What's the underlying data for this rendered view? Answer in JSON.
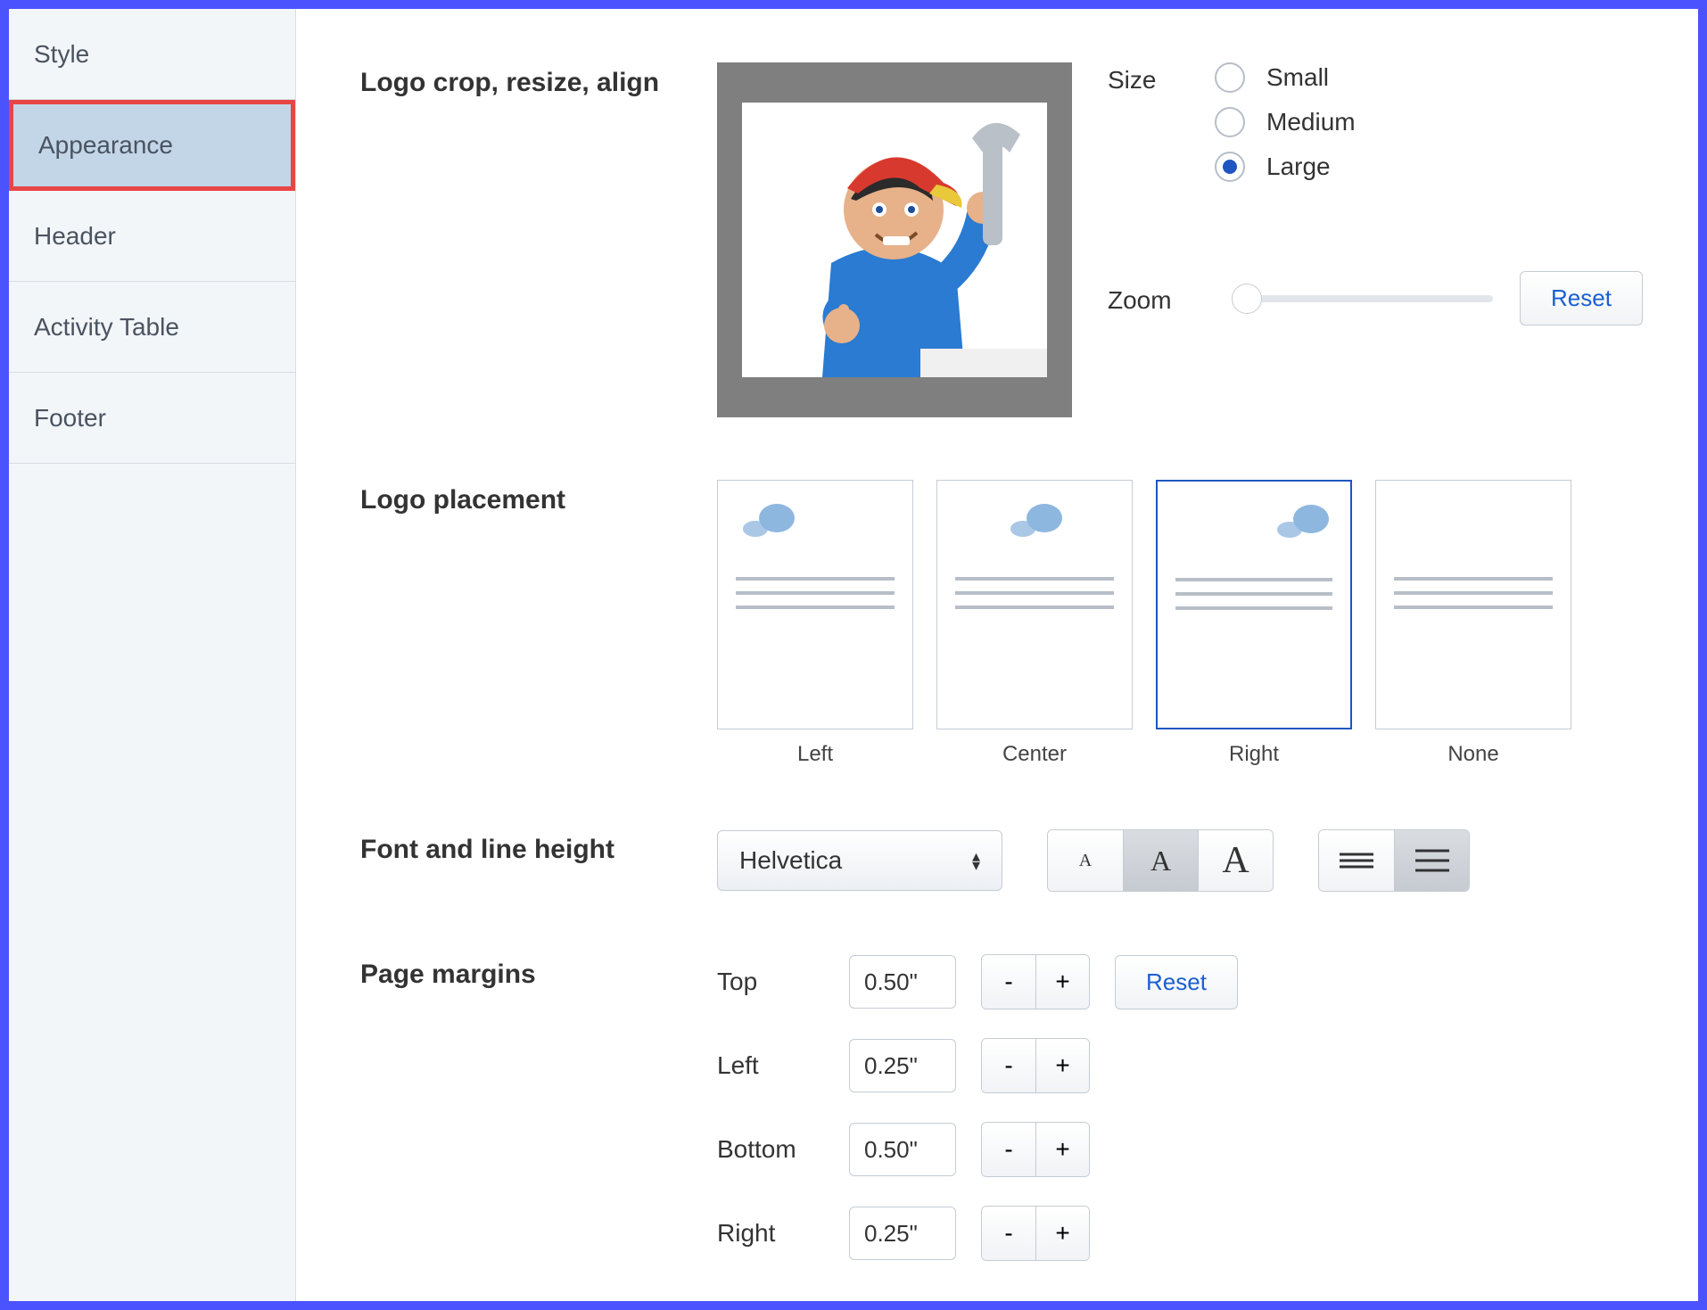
{
  "sidebar": {
    "items": [
      {
        "label": "Style"
      },
      {
        "label": "Appearance",
        "active": true
      },
      {
        "label": "Header"
      },
      {
        "label": "Activity Table"
      },
      {
        "label": "Footer"
      }
    ]
  },
  "logo": {
    "section_label": "Logo crop, resize, align",
    "size_label": "Size",
    "size_options": [
      "Small",
      "Medium",
      "Large"
    ],
    "size_selected": "Large",
    "zoom_label": "Zoom",
    "reset_label": "Reset"
  },
  "placement": {
    "section_label": "Logo placement",
    "options": [
      "Left",
      "Center",
      "Right",
      "None"
    ],
    "selected": "Right"
  },
  "font": {
    "section_label": "Font and line height",
    "family": "Helvetica",
    "font_size_selected": "medium",
    "line_height_selected": "loose"
  },
  "margins": {
    "section_label": "Page margins",
    "reset_label": "Reset",
    "rows": [
      {
        "label": "Top",
        "value": "0.50\""
      },
      {
        "label": "Left",
        "value": "0.25\""
      },
      {
        "label": "Bottom",
        "value": "0.50\""
      },
      {
        "label": "Right",
        "value": "0.25\""
      }
    ]
  }
}
